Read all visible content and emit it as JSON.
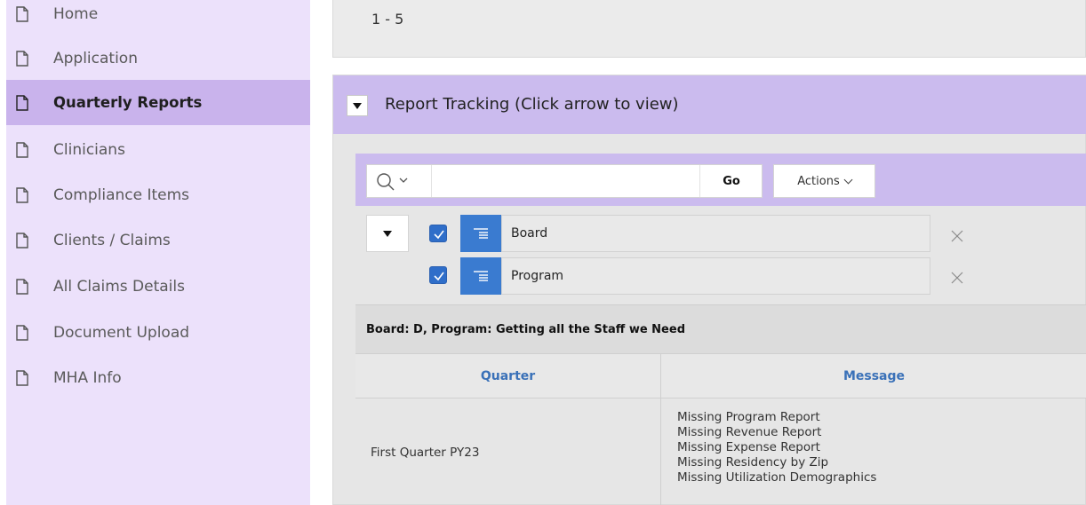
{
  "sidebar": {
    "items": [
      {
        "label": "Home"
      },
      {
        "label": "Application"
      },
      {
        "label": "Quarterly Reports"
      },
      {
        "label": "Clinicians"
      },
      {
        "label": "Compliance Items"
      },
      {
        "label": "Clients / Claims"
      },
      {
        "label": "All Claims Details"
      },
      {
        "label": "Document Upload"
      },
      {
        "label": "MHA Info"
      }
    ],
    "active_item": "Quarterly Reports",
    "icon": "page-icon"
  },
  "top_region": {
    "pagination": "1 - 5"
  },
  "report_tracking": {
    "title": "Report Tracking (Click arrow to view)",
    "toolbar": {
      "search_placeholder": "",
      "go_label": "Go",
      "actions_label": "Actions"
    },
    "control_breaks": [
      {
        "label": "Board",
        "checked": true
      },
      {
        "label": "Program",
        "checked": true
      }
    ],
    "break_header": "Board: D, Program: Getting all the Staff we Need",
    "columns": [
      "Quarter",
      "Message"
    ],
    "rows": [
      {
        "quarter": "First Quarter PY23",
        "messages": [
          "Missing Program Report",
          "Missing Revenue Report",
          "Missing Expense Report",
          "Missing Residency by Zip",
          "Missing Utilization Demographics"
        ]
      }
    ]
  },
  "colors": {
    "sidebar_bg": "#ece1fb",
    "sidebar_active": "#c9b3ec",
    "region_header": "#cbbbee",
    "checkbox": "#2f6ec9",
    "column_header_text": "#3a71b8"
  }
}
